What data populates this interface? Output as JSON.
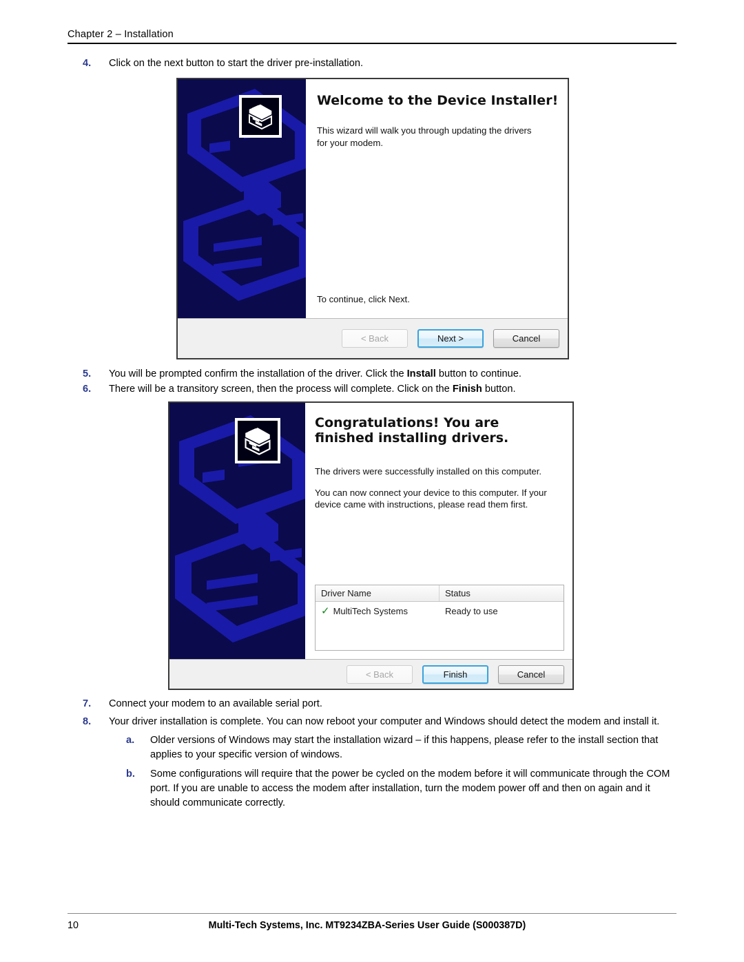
{
  "header": {
    "chapter": "Chapter 2 –  Installation"
  },
  "steps_top": [
    {
      "num": "4.",
      "text": "Click on the next button to start the driver pre-installation."
    }
  ],
  "steps_mid": [
    {
      "num": "5.",
      "pre": "You will be prompted confirm the installation of the driver. Click the ",
      "bold": "Install",
      "post": " button to continue."
    },
    {
      "num": "6.",
      "pre": "There will be a transitory screen, then the process will complete. Click on the ",
      "bold": "Finish",
      "post": " button."
    }
  ],
  "steps_bottom": [
    {
      "num": "7.",
      "text": "Connect your modem to an available serial port."
    },
    {
      "num": "8.",
      "text": "Your driver installation is complete. You can now reboot your computer and Windows should detect the modem and install it."
    }
  ],
  "substeps": [
    {
      "num": "a.",
      "text": "Older versions of Windows may start the installation wizard – if this happens, please refer to the install section that applies to your specific version of windows."
    },
    {
      "num": "b.",
      "text": "Some configurations will require that the power be cycled on the modem before it will communicate through the COM port. If you are unable to access the modem after installation, turn the modem power off and then on again and it should communicate correctly."
    }
  ],
  "dialog_welcome": {
    "title": "Welcome to the Device Installer!",
    "body": "This wizard will walk you through updating the drivers for your modem.",
    "hint": "To continue, click Next.",
    "icon_name": "device-installer-icon",
    "buttons": [
      {
        "label": "< Back",
        "state": "disabled"
      },
      {
        "label": "Next >",
        "state": "default"
      },
      {
        "label": "Cancel",
        "state": "normal"
      }
    ]
  },
  "dialog_finish": {
    "title": "Congratulations! You are finished installing drivers.",
    "body1": "The drivers were successfully installed on this computer.",
    "body2": "You can now connect your device to this computer. If your device came with instructions, please read them first.",
    "icon_name": "device-installer-icon",
    "table": {
      "columns": [
        "Driver Name",
        "Status"
      ],
      "rows": [
        {
          "check": "✓",
          "name": "MultiTech Systems",
          "status": "Ready to use"
        }
      ]
    },
    "buttons": [
      {
        "label": "< Back",
        "state": "disabled"
      },
      {
        "label": "Finish",
        "state": "default"
      },
      {
        "label": "Cancel",
        "state": "normal"
      }
    ]
  },
  "footer": {
    "page_number": "10",
    "document_title": "Multi-Tech Systems, Inc. MT9234ZBA-Series User Guide (S000387D)"
  },
  "colors": {
    "banner_dark": "#0a0a4d",
    "banner_light": "#1a1aa8",
    "accent_number": "#2b3a8f",
    "default_button_border": "#3aa3dd",
    "check_green": "#13881f"
  }
}
